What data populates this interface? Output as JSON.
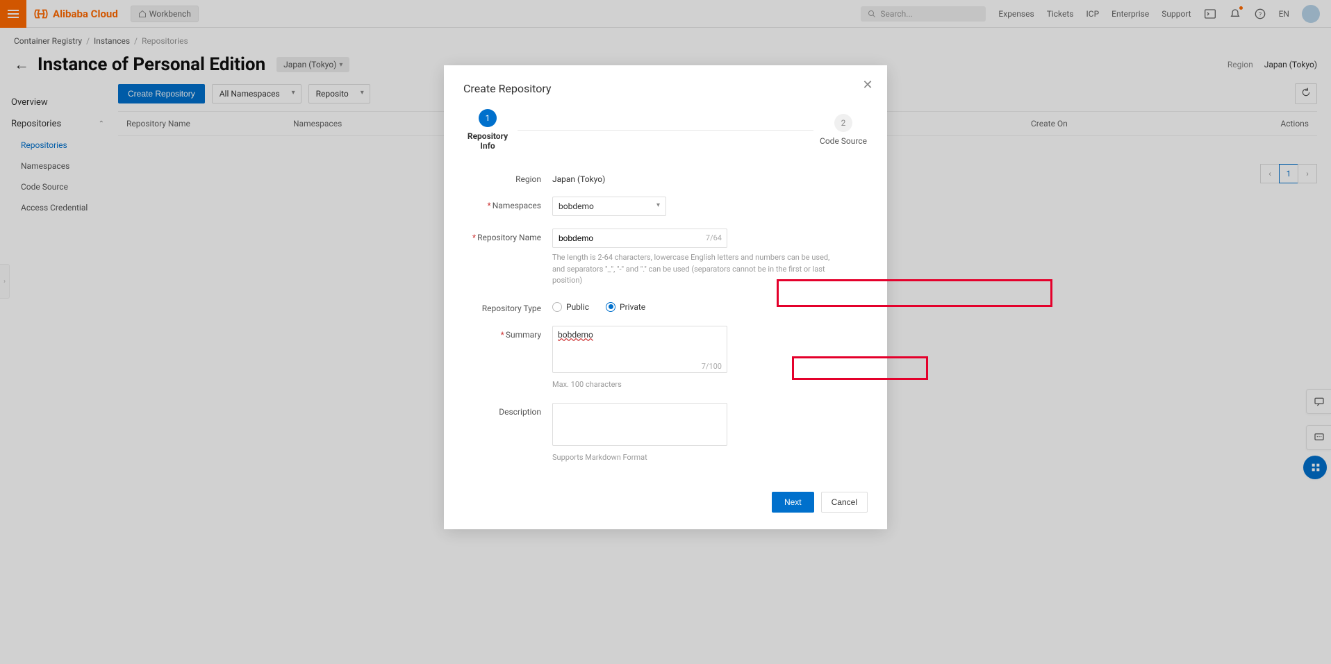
{
  "header": {
    "brand": "Alibaba Cloud",
    "workbench": "Workbench",
    "search_placeholder": "Search...",
    "links": {
      "expenses": "Expenses",
      "tickets": "Tickets",
      "icp": "ICP",
      "enterprise": "Enterprise",
      "support": "Support",
      "lang": "EN"
    }
  },
  "breadcrumb": {
    "a": "Container Registry",
    "b": "Instances",
    "c": "Repositories"
  },
  "title": {
    "pageTitle": "Instance of Personal Edition",
    "regionPill": "Japan (Tokyo)",
    "rightRegionLabel": "Region",
    "rightRegionValue": "Japan (Tokyo)"
  },
  "sidebar": {
    "overview": "Overview",
    "repositoriesGroup": "Repositories",
    "items": {
      "repositories": "Repositories",
      "namespaces": "Namespaces",
      "codeSource": "Code Source",
      "accessCredential": "Access Credential"
    }
  },
  "toolbar": {
    "create": "Create Repository",
    "namespaceFilter": "All Namespaces",
    "repoNameFilter": "Reposito"
  },
  "table": {
    "col1": "Repository Name",
    "col2": "Namespaces",
    "col3": "",
    "col4": "Create On",
    "col5": "Actions"
  },
  "pagination": {
    "current": "1"
  },
  "modal": {
    "title": "Create Repository",
    "step1": "Repository Info",
    "step2": "Code Source",
    "step1num": "1",
    "step2num": "2",
    "labels": {
      "region": "Region",
      "namespaces": "Namespaces",
      "repoName": "Repository Name",
      "repoType": "Repository Type",
      "summary": "Summary",
      "description": "Description"
    },
    "values": {
      "region": "Japan (Tokyo)",
      "namespace": "bobdemo",
      "repoName": "bobdemo",
      "repoNameCount": "7/64",
      "summary": "bobdemo",
      "summaryCount": "7/100",
      "publicLabel": "Public",
      "privateLabel": "Private"
    },
    "help": {
      "repoName": "The length is 2-64 characters, lowercase English letters and numbers can be used, and separators \"_\", \"-\" and \".\" can be used (separators cannot be in the first or last position)",
      "summary": "Max. 100 characters",
      "description": "Supports Markdown Format"
    },
    "footer": {
      "next": "Next",
      "cancel": "Cancel"
    }
  }
}
